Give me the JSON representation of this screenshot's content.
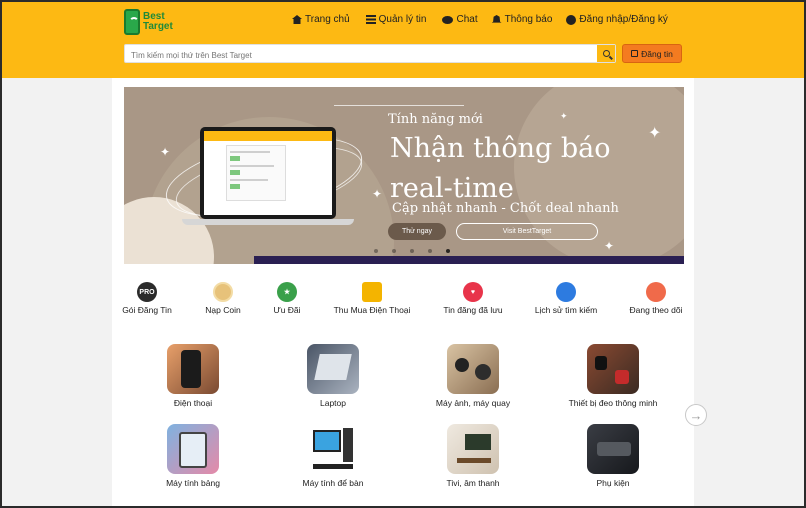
{
  "brand": {
    "logo_line1": "Best",
    "logo_line2": "Target"
  },
  "nav": [
    {
      "label": "Trang chủ",
      "icon": "home-icon"
    },
    {
      "label": "Quản lý tin",
      "icon": "list-icon"
    },
    {
      "label": "Chat",
      "icon": "chat-icon"
    },
    {
      "label": "Thông báo",
      "icon": "bell-icon"
    },
    {
      "label": "Đăng nhập/Đăng ký",
      "icon": "user-icon"
    }
  ],
  "search": {
    "placeholder": "Tìm kiếm mọi thứ trên Best Target"
  },
  "post_button": {
    "label": "Đăng tin"
  },
  "banner": {
    "subtitle": "Tính năng mới",
    "title": "Nhận thông báo real-time",
    "tagline": "Cập nhật nhanh - Chốt deal nhanh",
    "try_label": "Thử ngay",
    "visit_label": "Visit BestTarget"
  },
  "shortcuts": [
    {
      "label": "Gói Đăng Tin",
      "icon": "pro-badge-icon",
      "color": "#2b2b2b",
      "badge": "PRO"
    },
    {
      "label": "Nạp Coin",
      "icon": "coin-icon",
      "color": "#e7c27a",
      "badge": ""
    },
    {
      "label": "Ưu Đãi",
      "icon": "star-icon",
      "color": "#3aa04a",
      "badge": "★"
    },
    {
      "label": "Thu Mua Điện Thoại",
      "icon": "phone-shop-icon",
      "color": "#f4b400",
      "badge": ""
    },
    {
      "label": "Tin đăng đã lưu",
      "icon": "heart-icon",
      "color": "#e8344a",
      "badge": "♥"
    },
    {
      "label": "Lịch sử tìm kiếm",
      "icon": "bookmark-icon",
      "color": "#2d7be0",
      "badge": ""
    },
    {
      "label": "Đang theo dõi",
      "icon": "follow-icon",
      "color": "#f06a4a",
      "badge": ""
    }
  ],
  "categories": [
    {
      "label": "Điện thoại",
      "icon": "phone-icon"
    },
    {
      "label": "Laptop",
      "icon": "laptop-icon"
    },
    {
      "label": "Máy ảnh, máy quay",
      "icon": "camera-icon"
    },
    {
      "label": "Thiết bị đeo thông minh",
      "icon": "smartwatch-icon"
    },
    {
      "label": "Máy tính bảng",
      "icon": "tablet-icon"
    },
    {
      "label": "Máy tính để bàn",
      "icon": "desktop-icon"
    },
    {
      "label": "Tivi, âm thanh",
      "icon": "tv-icon"
    },
    {
      "label": "Phụ kiện",
      "icon": "accessories-icon"
    }
  ],
  "colors": {
    "header": "#fdb913",
    "post_button": "#f47b20",
    "banner": "#a99786"
  }
}
